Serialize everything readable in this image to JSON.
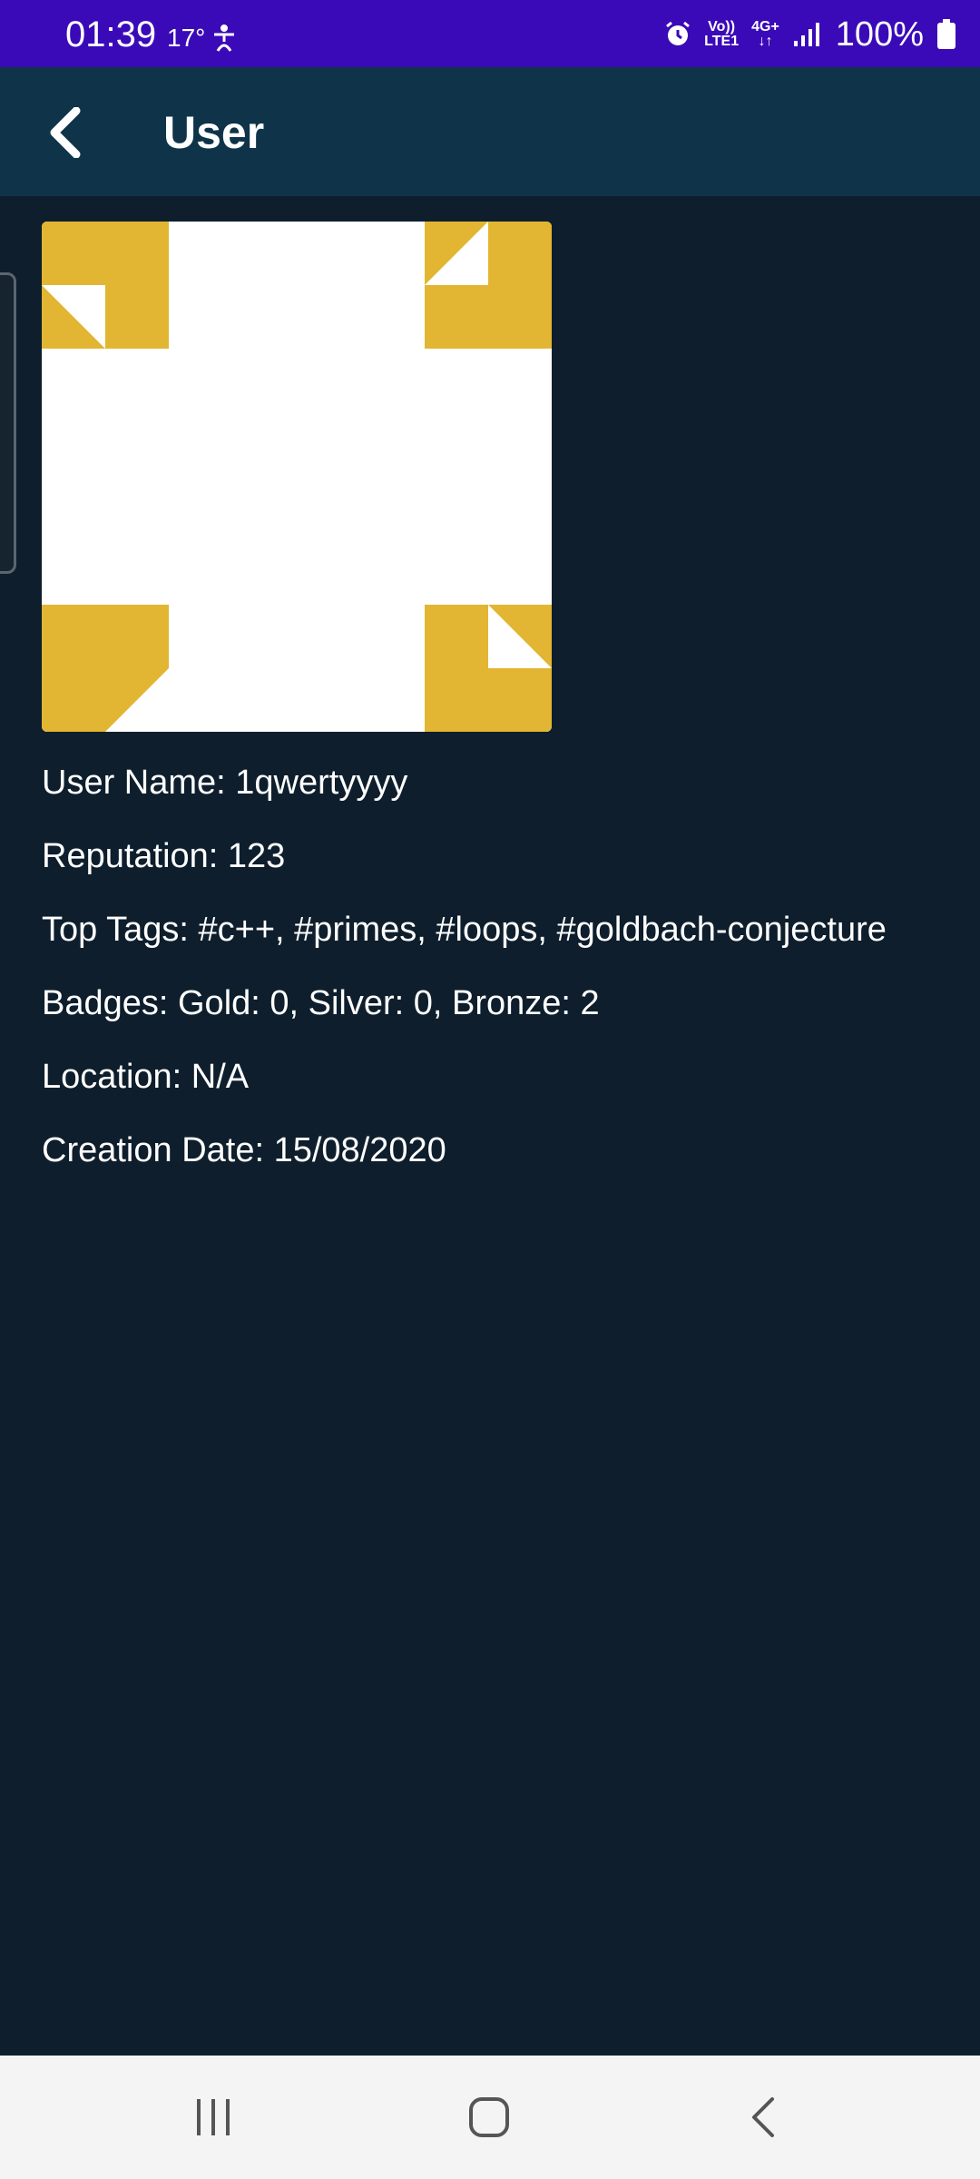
{
  "status_bar": {
    "time": "01:39",
    "temperature": "17°",
    "network_volte": "Vo))",
    "network_lte": "LTE1",
    "network_type": "4G+",
    "battery": "100%"
  },
  "app_bar": {
    "title": "User"
  },
  "user": {
    "lines": [
      "User Name: 1qwertyyyy",
      "Reputation: 123",
      "Top Tags: #c++, #primes, #loops, #goldbach-conjecture",
      "Badges: Gold: 0, Silver: 0, Bronze: 2",
      "Location: N/A",
      "Creation Date: 15/08/2020"
    ]
  },
  "colors": {
    "status_bar": "#3a0ab8",
    "app_bar": "#0f344a",
    "background": "#0e1e2c",
    "avatar_accent": "#e2b632",
    "text": "#ffffff"
  },
  "icons": {
    "back": "back-arrow-icon",
    "nav_recents": "recents-icon",
    "nav_home": "home-icon",
    "nav_back": "nav-back-icon"
  }
}
